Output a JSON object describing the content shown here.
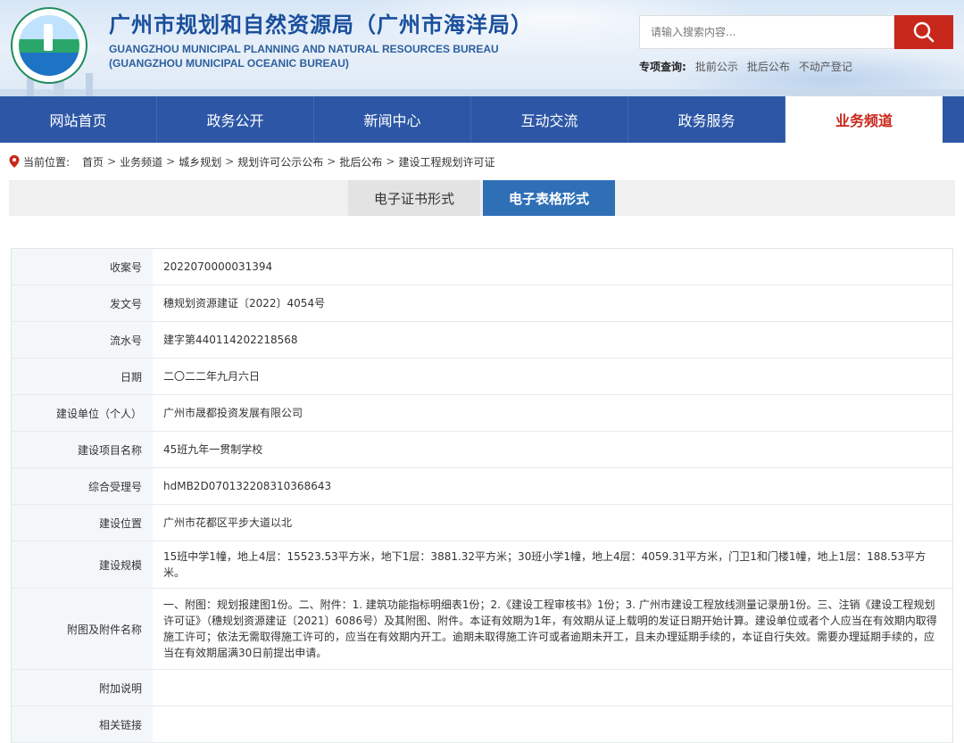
{
  "header": {
    "title_cn": "广州市规划和自然资源局（广州市海洋局）",
    "title_en_1": "GUANGZHOU MUNICIPAL PLANNING AND NATURAL RESOURCES BUREAU",
    "title_en_2": "(GUANGZHOU MUNICIPAL OCEANIC BUREAU)",
    "search_placeholder": "请输入搜索内容...",
    "quick_label": "专项查询:",
    "quick_links": [
      "批前公示",
      "批后公布",
      "不动产登记"
    ]
  },
  "nav": {
    "items": [
      "网站首页",
      "政务公开",
      "新闻中心",
      "互动交流",
      "政务服务",
      "业务频道"
    ],
    "active_index": 5
  },
  "breadcrumb": {
    "label": "当前位置:",
    "items": [
      "首页",
      "业务频道",
      "城乡规划",
      "规划许可公示公布",
      "批后公布",
      "建设工程规划许可证"
    ]
  },
  "tabs": {
    "items": [
      "电子证书形式",
      "电子表格形式"
    ],
    "active_index": 1
  },
  "record": [
    {
      "label": "收案号",
      "value": "2022070000031394"
    },
    {
      "label": "发文号",
      "value": "穗规划资源建证〔2022〕4054号"
    },
    {
      "label": "流水号",
      "value": "建字第440114202218568"
    },
    {
      "label": "日期",
      "value": "二〇二二年九月六日"
    },
    {
      "label": "建设单位（个人）",
      "value": "广州市晟都投资发展有限公司"
    },
    {
      "label": "建设项目名称",
      "value": "45班九年一贯制学校"
    },
    {
      "label": "综合受理号",
      "value": "hdMB2D070132208310368643"
    },
    {
      "label": "建设位置",
      "value": "广州市花都区平步大道以北"
    },
    {
      "label": "建设规模",
      "value": "15班中学1幢，地上4层：15523.53平方米，地下1层：3881.32平方米；30班小学1幢，地上4层：4059.31平方米，门卫1和门楼1幢，地上1层：188.53平方米。"
    },
    {
      "label": "附图及附件名称",
      "value": "一、附图：规划报建图1份。二、附件：1. 建筑功能指标明细表1份；2.《建设工程审核书》1份；3. 广州市建设工程放线测量记录册1份。三、注销《建设工程规划许可证》（穗规划资源建证〔2021〕6086号）及其附图、附件。本证有效期为1年，有效期从证上载明的发证日期开始计算。建设单位或者个人应当在有效期内取得施工许可；依法无需取得施工许可的，应当在有效期内开工。逾期未取得施工许可或者逾期未开工，且未办理延期手续的，本证自行失效。需要办理延期手续的，应当在有效期届满30日前提出申请。"
    },
    {
      "label": "附加说明",
      "value": ""
    },
    {
      "label": "相关链接",
      "value": ""
    }
  ]
}
